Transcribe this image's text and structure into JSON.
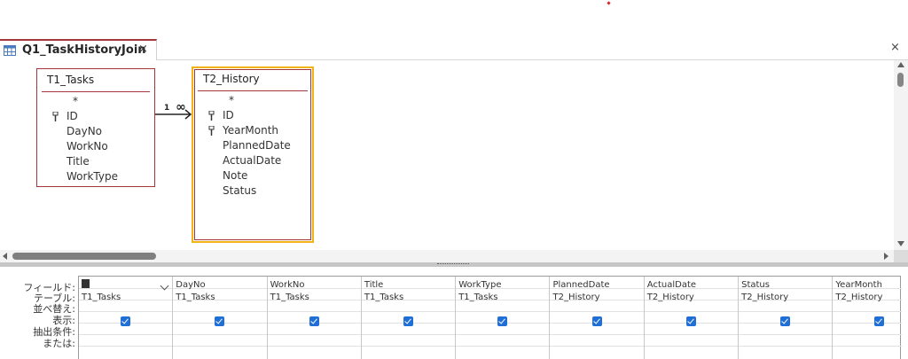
{
  "tab": {
    "title": "Q1_TaskHistoryJoin",
    "close_glyph": "×"
  },
  "window": {
    "close_glyph": "×"
  },
  "relationship": {
    "one_label": "1",
    "many_label": "∞"
  },
  "tables": [
    {
      "title": "T1_Tasks",
      "fields": [
        {
          "name": "*",
          "key": false
        },
        {
          "name": "ID",
          "key": true
        },
        {
          "name": "DayNo",
          "key": false
        },
        {
          "name": "WorkNo",
          "key": false
        },
        {
          "name": "Title",
          "key": false
        },
        {
          "name": "WorkType",
          "key": false
        }
      ]
    },
    {
      "title": "T2_History",
      "fields": [
        {
          "name": "*",
          "key": false
        },
        {
          "name": "ID",
          "key": true
        },
        {
          "name": "YearMonth",
          "key": true
        },
        {
          "name": "PlannedDate",
          "key": false
        },
        {
          "name": "ActualDate",
          "key": false
        },
        {
          "name": "Note",
          "key": false
        },
        {
          "name": "Status",
          "key": false
        }
      ]
    }
  ],
  "grid": {
    "row_labels": [
      "フィールド:",
      "テーブル:",
      "並べ替え:",
      "表示:",
      "抽出条件:",
      "または:"
    ],
    "columns": [
      {
        "field": "ID",
        "table": "T1_Tasks",
        "show": true
      },
      {
        "field": "DayNo",
        "table": "T1_Tasks",
        "show": true
      },
      {
        "field": "WorkNo",
        "table": "T1_Tasks",
        "show": true
      },
      {
        "field": "Title",
        "table": "T1_Tasks",
        "show": true
      },
      {
        "field": "WorkType",
        "table": "T1_Tasks",
        "show": true
      },
      {
        "field": "PlannedDate",
        "table": "T2_History",
        "show": true
      },
      {
        "field": "ActualDate",
        "table": "T2_History",
        "show": true
      },
      {
        "field": "Status",
        "table": "T2_History",
        "show": true
      },
      {
        "field": "YearMonth",
        "table": "T2_History",
        "show": true
      }
    ]
  },
  "colors": {
    "accent": "#a4373a",
    "selected_border": "#f2b316",
    "checkbox": "#1f6fd6"
  }
}
